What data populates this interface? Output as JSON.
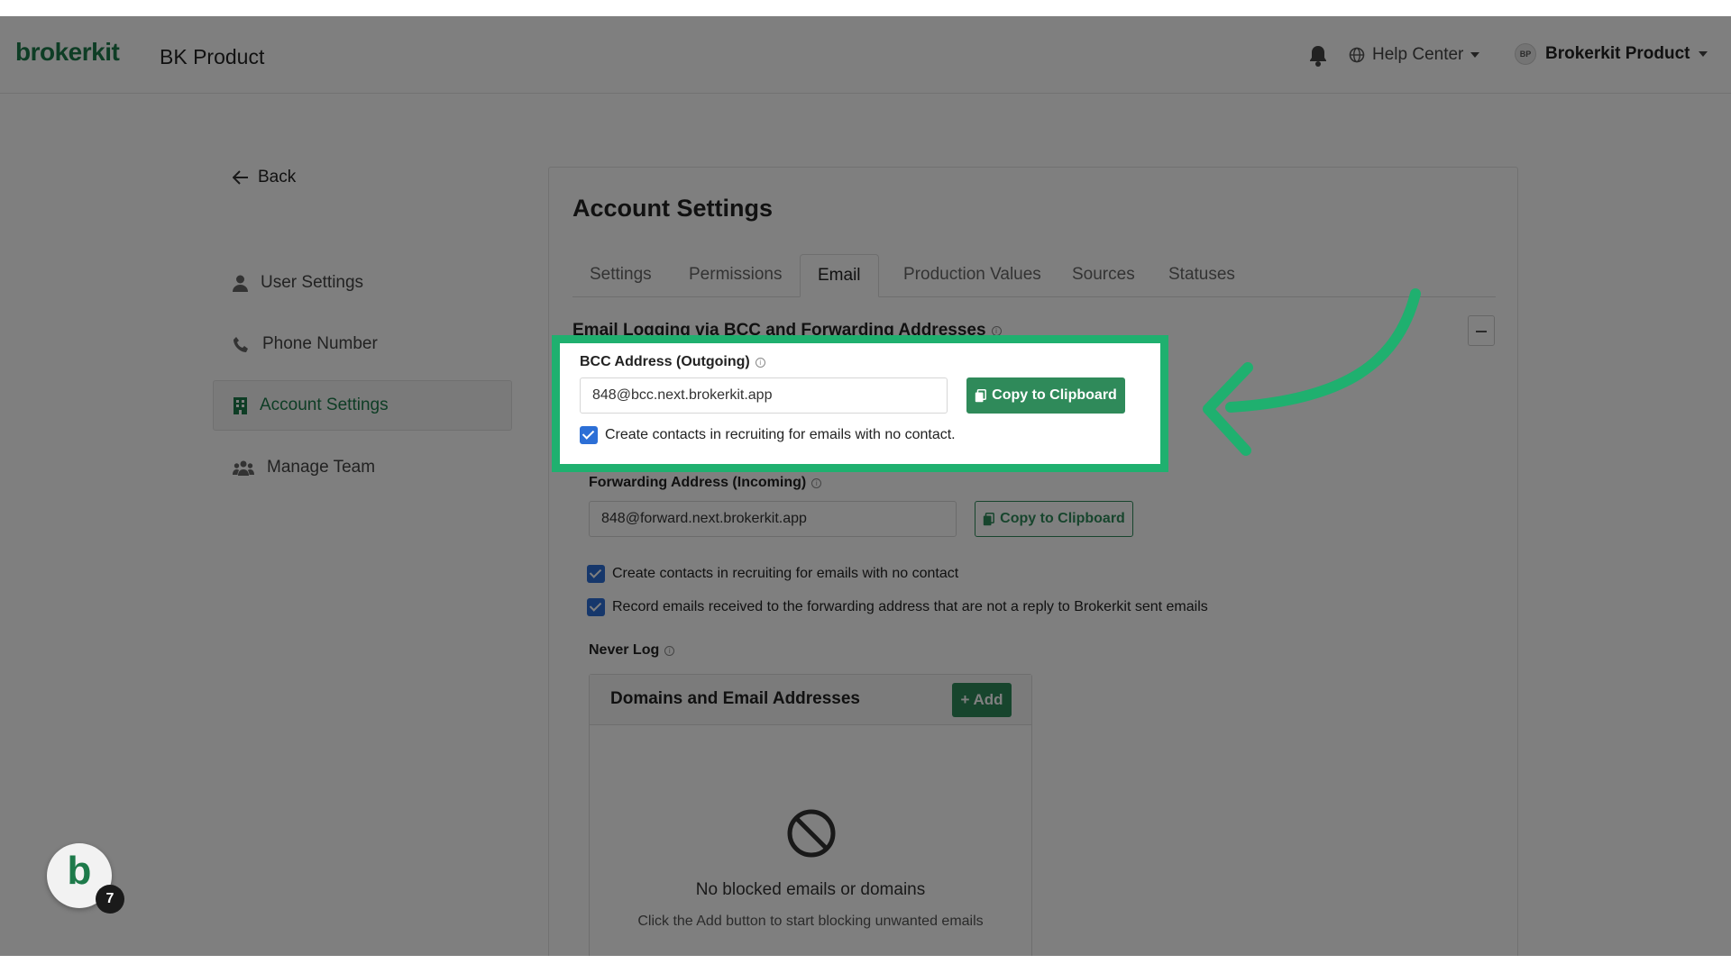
{
  "header": {
    "logo": "brokerkit",
    "product_name": "BK Product",
    "help_center": "Help Center",
    "user_initials": "BP",
    "user_name": "Brokerkit Product"
  },
  "sidebar": {
    "back_label": "Back",
    "items": [
      {
        "label": "User Settings",
        "icon": "user-icon"
      },
      {
        "label": "Phone Number",
        "icon": "phone-icon"
      },
      {
        "label": "Account Settings",
        "icon": "building-icon",
        "active": true
      },
      {
        "label": "Manage Team",
        "icon": "team-icon"
      }
    ]
  },
  "main": {
    "title": "Account Settings",
    "tabs": [
      {
        "label": "Settings"
      },
      {
        "label": "Permissions"
      },
      {
        "label": "Email",
        "active": true
      },
      {
        "label": "Production Values"
      },
      {
        "label": "Sources"
      },
      {
        "label": "Statuses"
      }
    ],
    "section_title": "Email Logging via BCC and Forwarding Addresses",
    "bcc": {
      "label": "BCC Address (Outgoing)",
      "value": "848@bcc.next.brokerkit.app",
      "button": "Copy to Clipboard",
      "checkbox_label": "Create contacts in recruiting for emails with no contact.",
      "checked": true
    },
    "forwarding": {
      "label": "Forwarding Address (Incoming)",
      "value": "848@forward.next.brokerkit.app",
      "button": "Copy to Clipboard",
      "checkbox1_label": "Create contacts in recruiting for emails with no contact",
      "checkbox2_label": "Record emails received to the forwarding address that are not a reply to Brokerkit sent emails"
    },
    "never_log": {
      "label": "Never Log",
      "panel_title": "Domains and Email Addresses",
      "add_button": "Add",
      "empty_title": "No blocked emails or domains",
      "empty_subtitle": "Click the Add button to start blocking unwanted emails"
    }
  },
  "chat_widget": {
    "letter": "b",
    "badge_count": "7"
  },
  "colors": {
    "brand_green": "#1d7a4a",
    "button_green": "#2f8a5a",
    "highlight_green": "#1fb06f",
    "checkbox_blue": "#2c6fd6"
  }
}
